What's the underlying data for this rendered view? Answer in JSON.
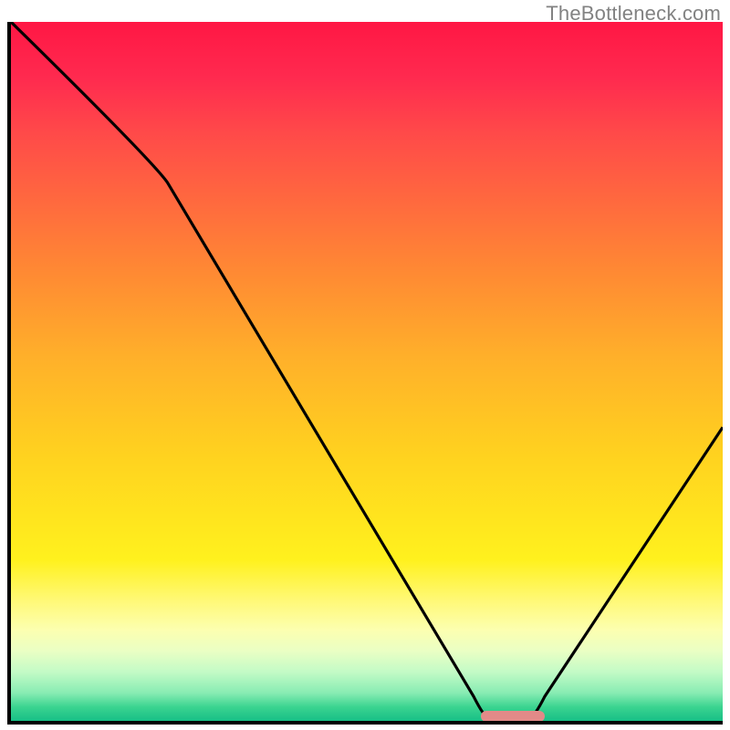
{
  "watermark": "TheBottleneck.com",
  "chart_data": {
    "type": "line",
    "title": "",
    "xlabel": "",
    "ylabel": "",
    "xlim": [
      0,
      100
    ],
    "ylim": [
      0,
      100
    ],
    "x": [
      0,
      22,
      67,
      73,
      100
    ],
    "y": [
      100,
      77,
      0.5,
      0.5,
      42
    ],
    "marker": {
      "x_start": 66,
      "x_end": 75,
      "y": 0
    },
    "grid": false,
    "annotations": []
  },
  "colors": {
    "top": "#ff1744",
    "bottom": "#17bf86",
    "axis": "#000000",
    "curve": "#000000",
    "marker": "#e28a88",
    "watermark": "#828282"
  }
}
